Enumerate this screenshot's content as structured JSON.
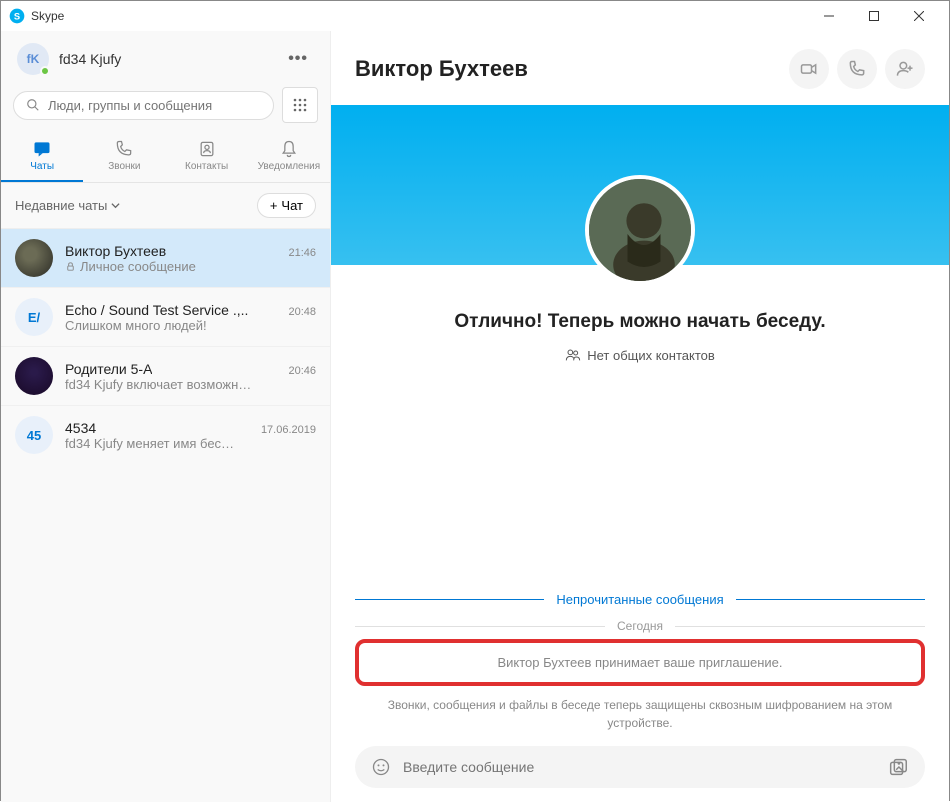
{
  "titlebar": {
    "title": "Skype"
  },
  "profile": {
    "initials": "fK",
    "name": "fd34 Kjufy"
  },
  "search": {
    "placeholder": "Люди, группы и сообщения"
  },
  "tabs": {
    "chats": "Чаты",
    "calls": "Звонки",
    "contacts": "Контакты",
    "notifications": "Уведомления"
  },
  "recents": {
    "label": "Недавние чаты",
    "new_chat": "Чат"
  },
  "chats": [
    {
      "initials": "",
      "name": "Виктор Бухтеев",
      "time": "21:46",
      "preview": "Личное сообщение",
      "lock": true
    },
    {
      "initials": "E/",
      "name": "Echo / Sound Test Service .,..",
      "time": "20:48",
      "preview": "Слишком много людей!"
    },
    {
      "initials": "",
      "name": "Родители 5-А",
      "time": "20:46",
      "preview": "fd34 Kjufy включает возможн…"
    },
    {
      "initials": "45",
      "name": "4534",
      "time": "17.06.2019",
      "preview": "fd34 Kjufy меняет имя бес…"
    }
  ],
  "conversation": {
    "title": "Виктор Бухтеев",
    "intro_title": "Отлично! Теперь можно начать беседу.",
    "intro_sub": "Нет общих контактов",
    "unread_label": "Непрочитанные сообщения",
    "date_label": "Сегодня",
    "accept_text": "Виктор Бухтеев принимает ваше приглашение.",
    "encryption_note": "Звонки, сообщения и файлы в беседе теперь защищены сквозным шифрованием на этом устройстве."
  },
  "composer": {
    "placeholder": "Введите сообщение"
  }
}
